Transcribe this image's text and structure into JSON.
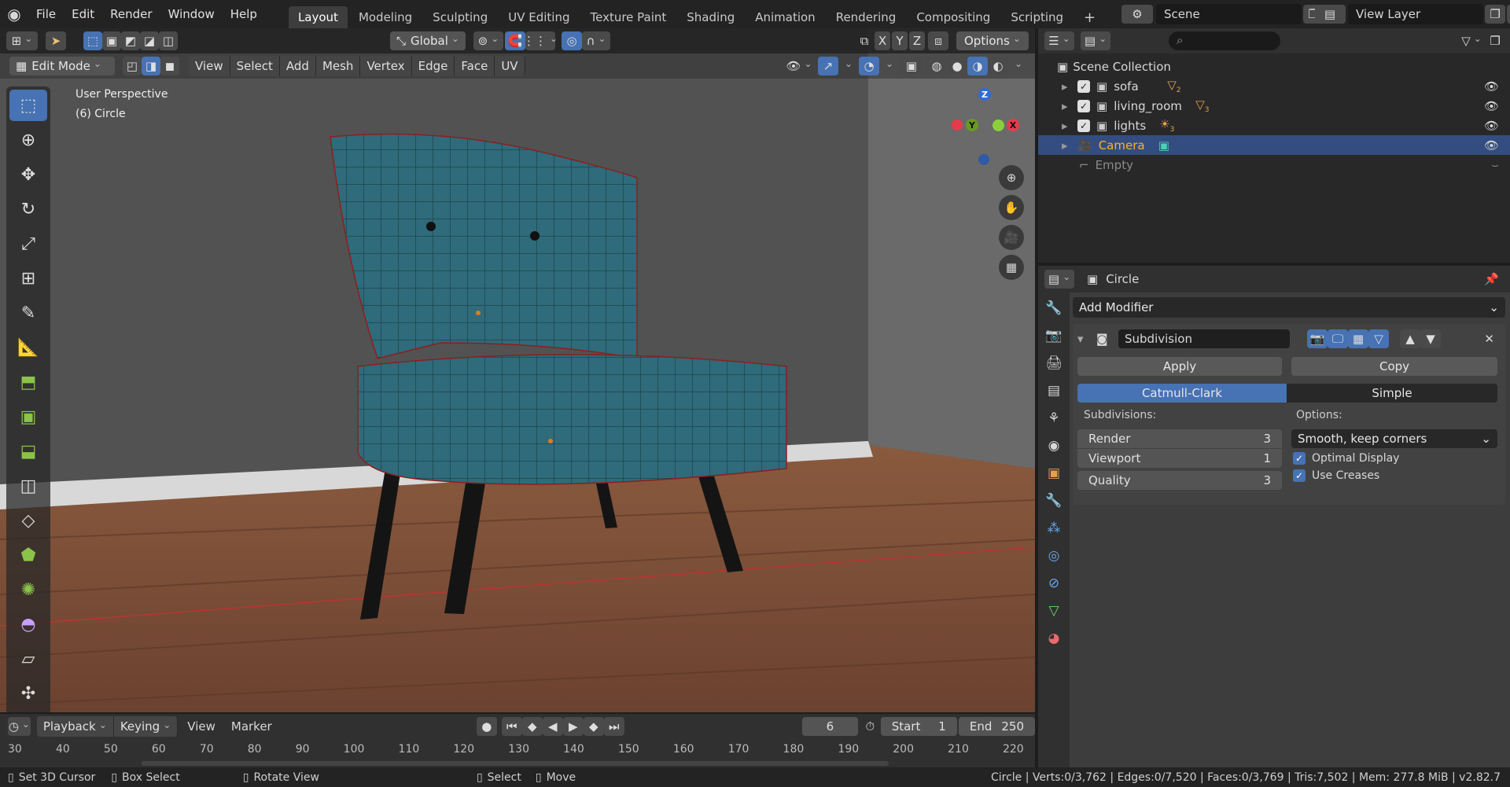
{
  "topbar": {
    "menus": [
      "File",
      "Edit",
      "Render",
      "Window",
      "Help"
    ],
    "workspaces": [
      "Layout",
      "Modeling",
      "Sculpting",
      "UV Editing",
      "Texture Paint",
      "Shading",
      "Animation",
      "Rendering",
      "Compositing",
      "Scripting"
    ],
    "active_workspace": "Layout",
    "scene": "Scene",
    "view_layer": "View Layer"
  },
  "viewport": {
    "transform_orientation": "Global",
    "axes": [
      "X",
      "Y",
      "Z"
    ],
    "options_label": "Options",
    "mode": "Edit Mode",
    "menus": [
      "View",
      "Select",
      "Add",
      "Mesh",
      "Vertex",
      "Edge",
      "Face",
      "UV"
    ],
    "view_name": "User Perspective",
    "object_label": "(6) Circle",
    "gizmo": {
      "z": "Z",
      "y": "Y",
      "x": "X"
    }
  },
  "timeline": {
    "menus": [
      "Playback",
      "Keying",
      "View",
      "Marker"
    ],
    "current_frame": "6",
    "start_label": "Start",
    "start": "1",
    "end_label": "End",
    "end": "250",
    "ruler": [
      "30",
      "40",
      "50",
      "60",
      "70",
      "80",
      "90",
      "100",
      "110",
      "120",
      "130",
      "140",
      "150",
      "160",
      "170",
      "180",
      "190",
      "200",
      "210",
      "220"
    ]
  },
  "statusbar": {
    "left": [
      "Set 3D Cursor",
      "Box Select",
      "Rotate View",
      "Select",
      "Move"
    ],
    "right": "Circle | Verts:0/3,762 | Edges:0/7,520 | Faces:0/3,769 | Tris:7,502 | Mem: 277.8 MiB | v2.82.7"
  },
  "outliner": {
    "root": "Scene Collection",
    "items": [
      {
        "name": "sofa",
        "badge": "2"
      },
      {
        "name": "living_room",
        "badge": "3"
      },
      {
        "name": "lights",
        "badge": "3"
      },
      {
        "name": "Camera",
        "badge": ""
      },
      {
        "name": "Empty",
        "badge": ""
      }
    ]
  },
  "properties": {
    "object": "Circle",
    "add_modifier": "Add Modifier",
    "modifier_name": "Subdivision",
    "apply": "Apply",
    "copy": "Copy",
    "mode_catmull": "Catmull-Clark",
    "mode_simple": "Simple",
    "subdivisions_label": "Subdivisions:",
    "render_label": "Render",
    "render_value": "3",
    "viewport_label": "Viewport",
    "viewport_value": "1",
    "quality_label": "Quality",
    "quality_value": "3",
    "options_label": "Options:",
    "uv_smooth": "Smooth, keep corners",
    "optimal_display": "Optimal Display",
    "use_creases": "Use Creases"
  },
  "colors": {
    "accent": "#4772b3",
    "selected_row": "#334d80",
    "camera_text": "#ffaf29"
  }
}
